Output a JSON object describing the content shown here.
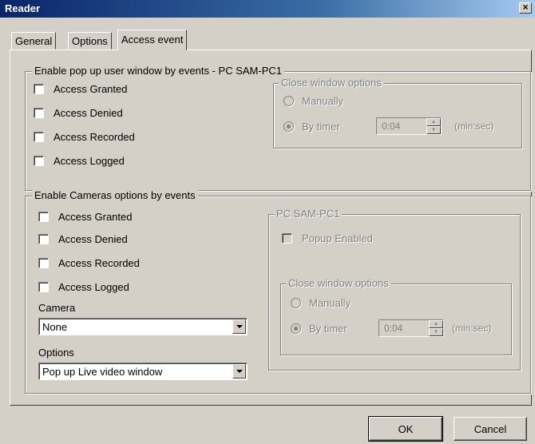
{
  "window": {
    "title": "Reader",
    "close_glyph": "×"
  },
  "tabs": [
    {
      "label": "General"
    },
    {
      "label": "Options"
    },
    {
      "label": "Access event"
    }
  ],
  "popup_group": {
    "legend": "Enable pop up user window by events - PC SAM-PC1",
    "events": [
      {
        "label": "Access Granted",
        "checked": false
      },
      {
        "label": "Access Denied",
        "checked": false
      },
      {
        "label": "Access Recorded",
        "checked": false
      },
      {
        "label": "Access Logged",
        "checked": false
      }
    ],
    "close_options": {
      "legend": "Close window options",
      "manually_label": "Manually",
      "by_timer_label": "By timer",
      "selected": "By timer",
      "timer_value": "0:04",
      "unit": "(min:sec)"
    }
  },
  "cameras_group": {
    "legend": "Enable Cameras options by events",
    "events": [
      {
        "label": "Access Granted",
        "checked": false
      },
      {
        "label": "Access Denied",
        "checked": false
      },
      {
        "label": "Access Recorded",
        "checked": false
      },
      {
        "label": "Access Logged",
        "checked": false
      }
    ],
    "camera_label": "Camera",
    "camera_value": "None",
    "options_label": "Options",
    "options_value": "Pop up Live video window",
    "pc_group": {
      "legend": "PC SAM-PC1",
      "popup_enabled_label": "Popup Enabled",
      "close_options": {
        "legend": "Close window options",
        "manually_label": "Manually",
        "by_timer_label": "By timer",
        "selected": "By timer",
        "timer_value": "0:04",
        "unit": "(min:sec)"
      }
    }
  },
  "buttons": {
    "ok": "OK",
    "cancel": "Cancel"
  }
}
